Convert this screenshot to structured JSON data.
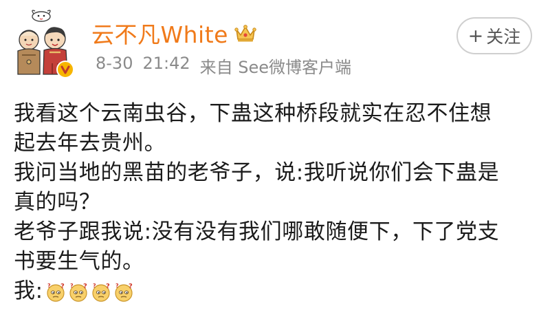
{
  "post": {
    "username": "云不凡White",
    "date": "8-30",
    "time": "21:42",
    "source": "来自 See微博客户端",
    "follow_label": "关注",
    "follow_plus": "+",
    "body_lines": [
      "我看这个云南虫谷，下蛊这种桥段就实在忍不住想",
      "起去年去贵州。",
      "我问当地的黑苗的老爷子，说:我听说你们会下蛊是",
      "真的吗？",
      "老爷子跟我说:没有没有我们哪敢随便下，下了党支",
      "书要生气的。"
    ],
    "last_line_prefix": "我:",
    "emoji_names": [
      "doge-question-icon",
      "doge-question-icon",
      "doge-question-icon",
      "doge-question-icon"
    ]
  },
  "colors": {
    "username": "#f07a1a",
    "meta": "#8a8a8a",
    "verify_badge": "#f7b500"
  }
}
